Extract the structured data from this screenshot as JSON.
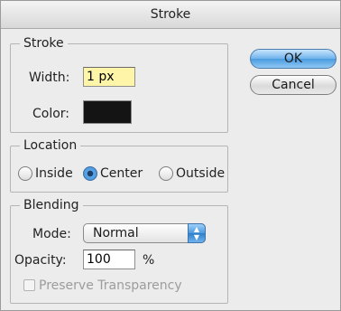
{
  "dialog": {
    "title": "Stroke"
  },
  "stroke": {
    "legend": "Stroke",
    "width_label": "Width:",
    "width_value": "1 px",
    "color_label": "Color:",
    "color_value": "#141414"
  },
  "buttons": {
    "ok": "OK",
    "cancel": "Cancel"
  },
  "location": {
    "legend": "Location",
    "options": [
      "Inside",
      "Center",
      "Outside"
    ],
    "selected": "Center"
  },
  "blending": {
    "legend": "Blending",
    "mode_label": "Mode:",
    "mode_value": "Normal",
    "opacity_label": "Opacity:",
    "opacity_value": "100",
    "opacity_unit": "%",
    "preserve_label": "Preserve Transparency",
    "preserve_checked": false,
    "preserve_enabled": false
  }
}
